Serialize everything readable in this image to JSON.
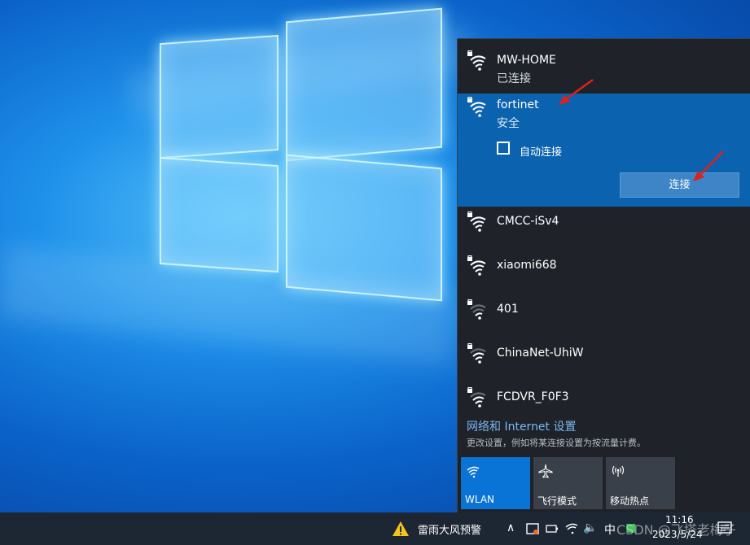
{
  "networks": [
    {
      "name": "MW-HOME",
      "status": "已连接"
    },
    {
      "name": "fortinet",
      "status": "安全",
      "auto_connect_label": "自动连接",
      "connect_label": "连接"
    },
    {
      "name": "CMCC-iSv4"
    },
    {
      "name": "xiaomi668"
    },
    {
      "name": "401"
    },
    {
      "name": "ChinaNet-UhiW"
    },
    {
      "name": "FCDVR_F0F3"
    }
  ],
  "settings": {
    "link": "网络和 Internet 设置",
    "description": "更改设置，例如将某连接设置为按流量计费。"
  },
  "quick_actions": [
    {
      "label": "WLAN",
      "icon": "wifi-icon",
      "active": true
    },
    {
      "label": "飞行模式",
      "icon": "airplane-icon",
      "active": false
    },
    {
      "label": "移动热点",
      "icon": "hotspot-icon",
      "active": false
    }
  ],
  "taskbar": {
    "weather": "雷雨大风预警",
    "weather_icon": "warning-icon",
    "input_method": "中",
    "time": "11:16",
    "date": "2023/5/24",
    "watermark": "CSDN @飞塔老梅子"
  },
  "colors": {
    "selected_network": "#0b63b0",
    "flyout_bg": "#1f2329",
    "active_tile": "#0a74d6",
    "link": "#79b8f2",
    "warning": "#f5c518",
    "annotation_arrow": "#e0201c"
  }
}
